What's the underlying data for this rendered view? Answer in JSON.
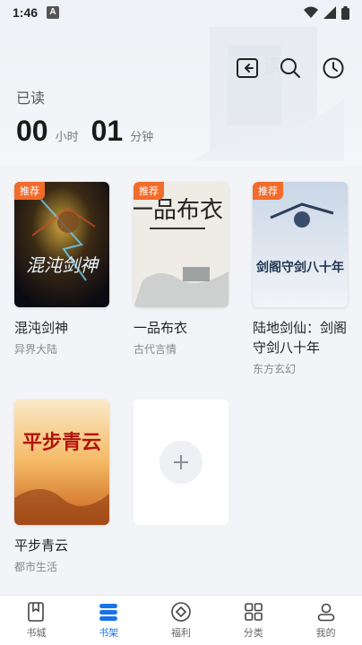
{
  "status_bar": {
    "time": "1:46",
    "notification_badge": "A"
  },
  "header": {
    "read_label": "已读",
    "hours_value": "00",
    "hours_unit": "小时",
    "minutes_value": "01",
    "minutes_unit": "分钟"
  },
  "top_actions": {
    "icons": [
      "back-to-shelf-icon",
      "search-icon",
      "history-clock-icon"
    ]
  },
  "books": [
    {
      "title": "混沌剑神",
      "category": "异界大陆",
      "tag": "推荐",
      "cover_text": "混沌剑神"
    },
    {
      "title": "一品布衣",
      "category": "古代言情",
      "tag": "推荐",
      "cover_text": "一品布衣"
    },
    {
      "title": "陆地剑仙：剑阁守剑八十年",
      "category": "东方玄幻",
      "tag": "推荐",
      "cover_text": "剑阁守剑八十年"
    },
    {
      "title": "平步青云",
      "category": "都市生活",
      "tag": "",
      "cover_text": "平步青云"
    }
  ],
  "tabbar": {
    "items": [
      {
        "label": "书城",
        "icon": "book-icon"
      },
      {
        "label": "书架",
        "icon": "shelf-icon",
        "active": true
      },
      {
        "label": "福利",
        "icon": "diamond-icon"
      },
      {
        "label": "分类",
        "icon": "grid-icon"
      },
      {
        "label": "我的",
        "icon": "user-icon"
      }
    ]
  },
  "colors": {
    "accent": "#1a73e8",
    "tag": "#f26b2a"
  }
}
